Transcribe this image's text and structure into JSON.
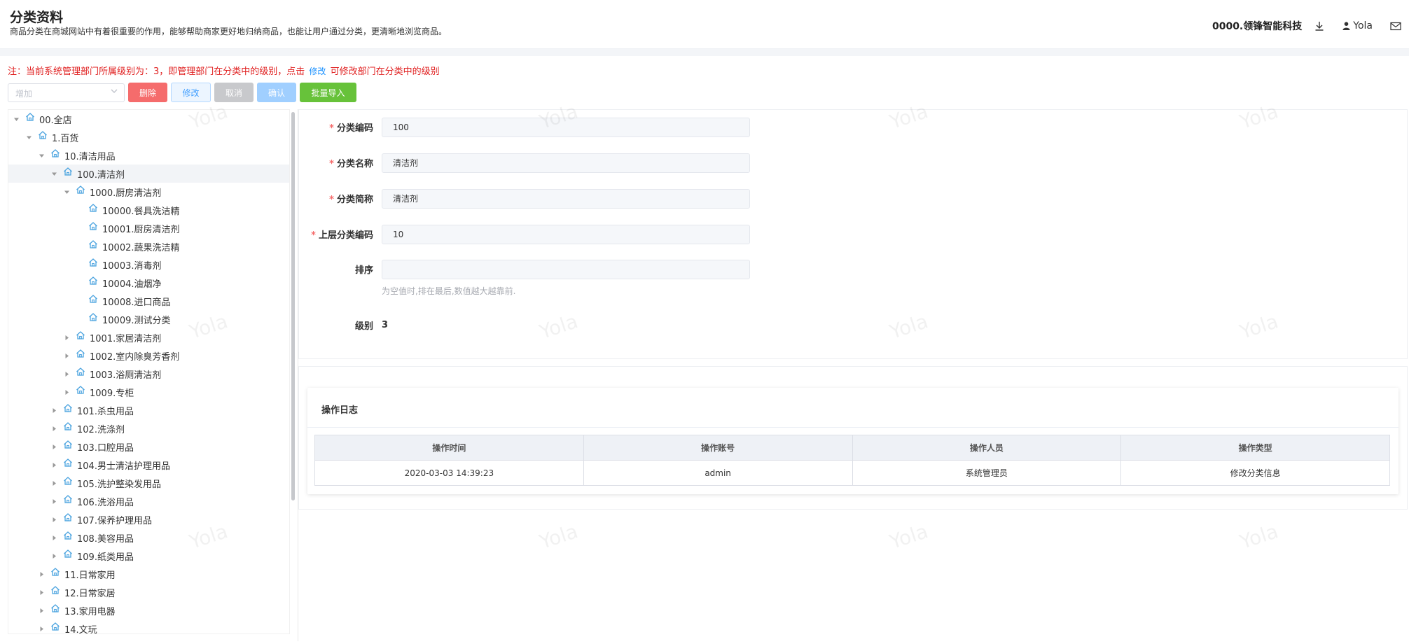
{
  "header": {
    "title": "分类资料",
    "subtitle": "商品分类在商城网站中有着很重要的作用，能够帮助商家更好地归纳商品，也能让用户通过分类，更清晰地浏览商品。",
    "company": "0000.领锋智能科技",
    "user": "Yola"
  },
  "notice": {
    "prefix": "注：当前系统管理部门所属级别为：3，即管理部门在分类中的级别，点击",
    "link": "修改",
    "suffix": "可修改部门在分类中的级别"
  },
  "toolbar": {
    "select_placeholder": "增加",
    "delete_label": "删除",
    "edit_label": "修改",
    "cancel_label": "取消",
    "confirm_label": "确认",
    "import_label": "批量导入"
  },
  "tree": [
    {
      "label": "00.全店",
      "level": 0,
      "expanded": true
    },
    {
      "label": "1.百货",
      "level": 1,
      "expanded": true
    },
    {
      "label": "10.清洁用品",
      "level": 2,
      "expanded": true
    },
    {
      "label": "100.清洁剂",
      "level": 3,
      "expanded": true,
      "selected": true
    },
    {
      "label": "1000.厨房清洁剂",
      "level": 4,
      "expanded": true
    },
    {
      "label": "10000.餐具洗洁精",
      "level": 5,
      "leaf": true
    },
    {
      "label": "10001.厨房清洁剂",
      "level": 5,
      "leaf": true
    },
    {
      "label": "10002.蔬果洗洁精",
      "level": 5,
      "leaf": true
    },
    {
      "label": "10003.消毒剂",
      "level": 5,
      "leaf": true
    },
    {
      "label": "10004.油烟净",
      "level": 5,
      "leaf": true
    },
    {
      "label": "10008.进口商品",
      "level": 5,
      "leaf": true
    },
    {
      "label": "10009.测试分类",
      "level": 5,
      "leaf": true
    },
    {
      "label": "1001.家居清洁剂",
      "level": 4,
      "expanded": false
    },
    {
      "label": "1002.室内除臭芳香剂",
      "level": 4,
      "expanded": false
    },
    {
      "label": "1003.浴厕清洁剂",
      "level": 4,
      "expanded": false
    },
    {
      "label": "1009.专柜",
      "level": 4,
      "expanded": false
    },
    {
      "label": "101.杀虫用品",
      "level": 3,
      "expanded": false
    },
    {
      "label": "102.洗涤剂",
      "level": 3,
      "expanded": false
    },
    {
      "label": "103.口腔用品",
      "level": 3,
      "expanded": false
    },
    {
      "label": "104.男士清洁护理用品",
      "level": 3,
      "expanded": false
    },
    {
      "label": "105.洗护整染发用品",
      "level": 3,
      "expanded": false
    },
    {
      "label": "106.洗浴用品",
      "level": 3,
      "expanded": false
    },
    {
      "label": "107.保养护理用品",
      "level": 3,
      "expanded": false
    },
    {
      "label": "108.美容用品",
      "level": 3,
      "expanded": false
    },
    {
      "label": "109.纸类用品",
      "level": 3,
      "expanded": false
    },
    {
      "label": "11.日常家用",
      "level": 2,
      "expanded": false
    },
    {
      "label": "12.日常家居",
      "level": 2,
      "expanded": false
    },
    {
      "label": "13.家用电器",
      "level": 2,
      "expanded": false
    },
    {
      "label": "14.文玩",
      "level": 2,
      "expanded": false
    }
  ],
  "form": {
    "code_label": "分类编码",
    "code_value": "100",
    "name_label": "分类名称",
    "name_value": "清洁剂",
    "short_label": "分类简称",
    "short_value": "清洁剂",
    "parent_label": "上层分类编码",
    "parent_value": "10",
    "sort_label": "排序",
    "sort_value": "",
    "sort_hint": "为空值时,排在最后,数值越大越靠前.",
    "level_label": "级别",
    "level_value": "3"
  },
  "log": {
    "title": "操作日志",
    "columns": [
      "操作时间",
      "操作账号",
      "操作人员",
      "操作类型"
    ],
    "rows": [
      [
        "2020-03-03 14:39:23",
        "admin",
        "系统管理员",
        "修改分类信息"
      ]
    ]
  },
  "watermark": "Yola",
  "colors": {
    "danger": "#f56c6c",
    "primary": "#409eff",
    "success": "#67c23a",
    "notice": "#e02020",
    "tree_icon": "#4aa3df"
  }
}
